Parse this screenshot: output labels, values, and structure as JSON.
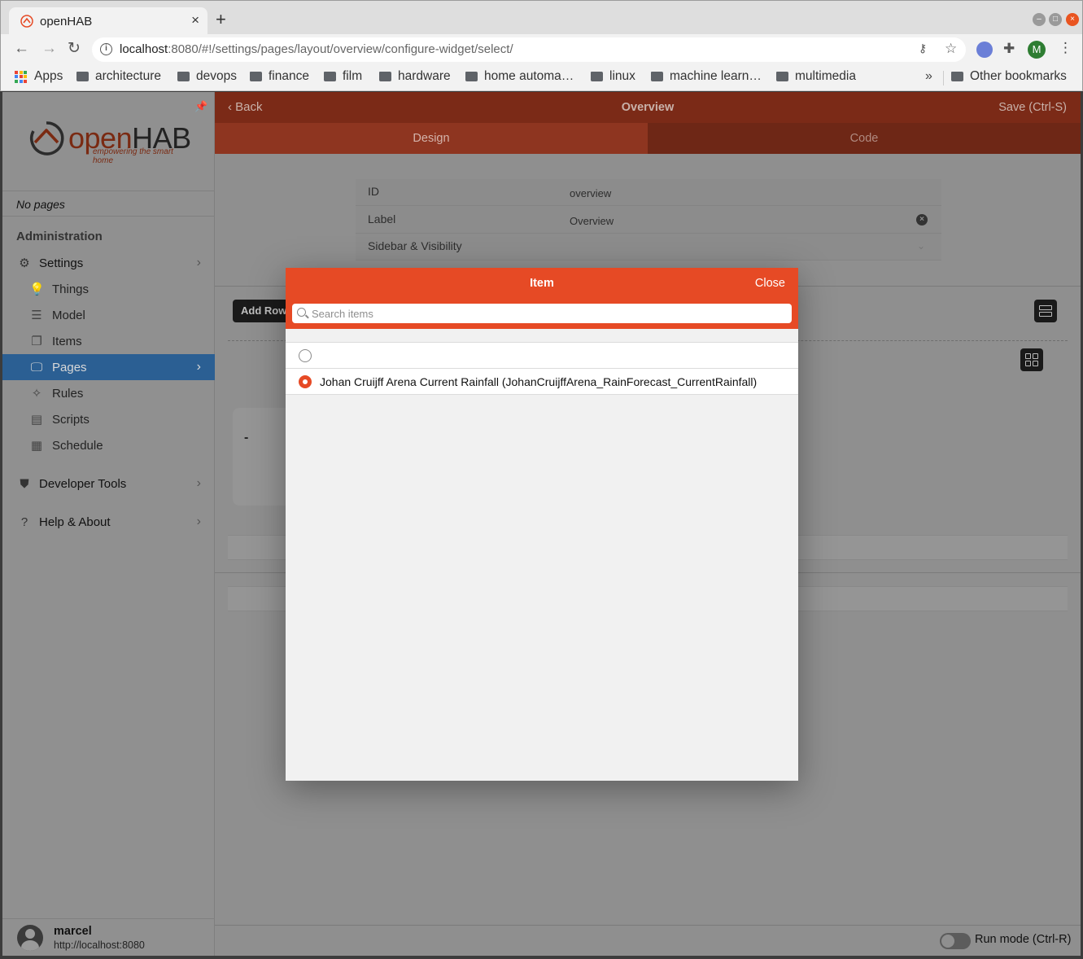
{
  "browser": {
    "tab_title": "openHAB",
    "url_host": "localhost",
    "url_rest": ":8080/#!/settings/pages/layout/overview/configure-widget/select/",
    "profile_initial": "M",
    "bookmarks": [
      "Apps",
      "architecture",
      "devops",
      "finance",
      "film",
      "hardware",
      "home automa…",
      "linux",
      "machine learn…",
      "multimedia"
    ],
    "bookmarks_more": "»",
    "other_bookmarks": "Other bookmarks"
  },
  "sidebar": {
    "logo_open": "open",
    "logo_hab": "HAB",
    "logo_tagline": "empowering the smart home",
    "no_pages": "No pages",
    "admin_title": "Administration",
    "items": [
      {
        "label": "Settings",
        "icon": "gear-icon"
      },
      {
        "label": "Things",
        "icon": "lightbulb-icon"
      },
      {
        "label": "Model",
        "icon": "list-tree-icon"
      },
      {
        "label": "Items",
        "icon": "copy-icon"
      },
      {
        "label": "Pages",
        "icon": "monitor-icon"
      },
      {
        "label": "Rules",
        "icon": "wand-icon"
      },
      {
        "label": "Scripts",
        "icon": "document-icon"
      },
      {
        "label": "Schedule",
        "icon": "calendar-icon"
      },
      {
        "label": "Developer Tools",
        "icon": "shield-icon"
      },
      {
        "label": "Help & About",
        "icon": "help-icon"
      }
    ],
    "user": {
      "name": "marcel",
      "url": "http://localhost:8080"
    }
  },
  "editor": {
    "back": "Back",
    "title": "Overview",
    "save": "Save (Ctrl-S)",
    "tabs": {
      "design": "Design",
      "code": "Code"
    },
    "form": {
      "id_label": "ID",
      "id_value": "overview",
      "label_label": "Label",
      "label_value": "Overview",
      "sidebar_visibility": "Sidebar & Visibility"
    },
    "add_row": "Add Row",
    "widget_placeholder": "-",
    "run_mode": "Run mode (Ctrl-R)"
  },
  "dialog": {
    "title": "Item",
    "close": "Close",
    "search_placeholder": "Search items",
    "items": [
      {
        "label": "",
        "selected": false
      },
      {
        "label": "Johan Cruijff Arena Current Rainfall (JohanCruijffArena_RainForecast_CurrentRainfall)",
        "selected": true
      }
    ]
  },
  "colors": {
    "accent": "#e64a25",
    "header_dim": "#7b2a17",
    "active_nav": "#2b5f93"
  }
}
